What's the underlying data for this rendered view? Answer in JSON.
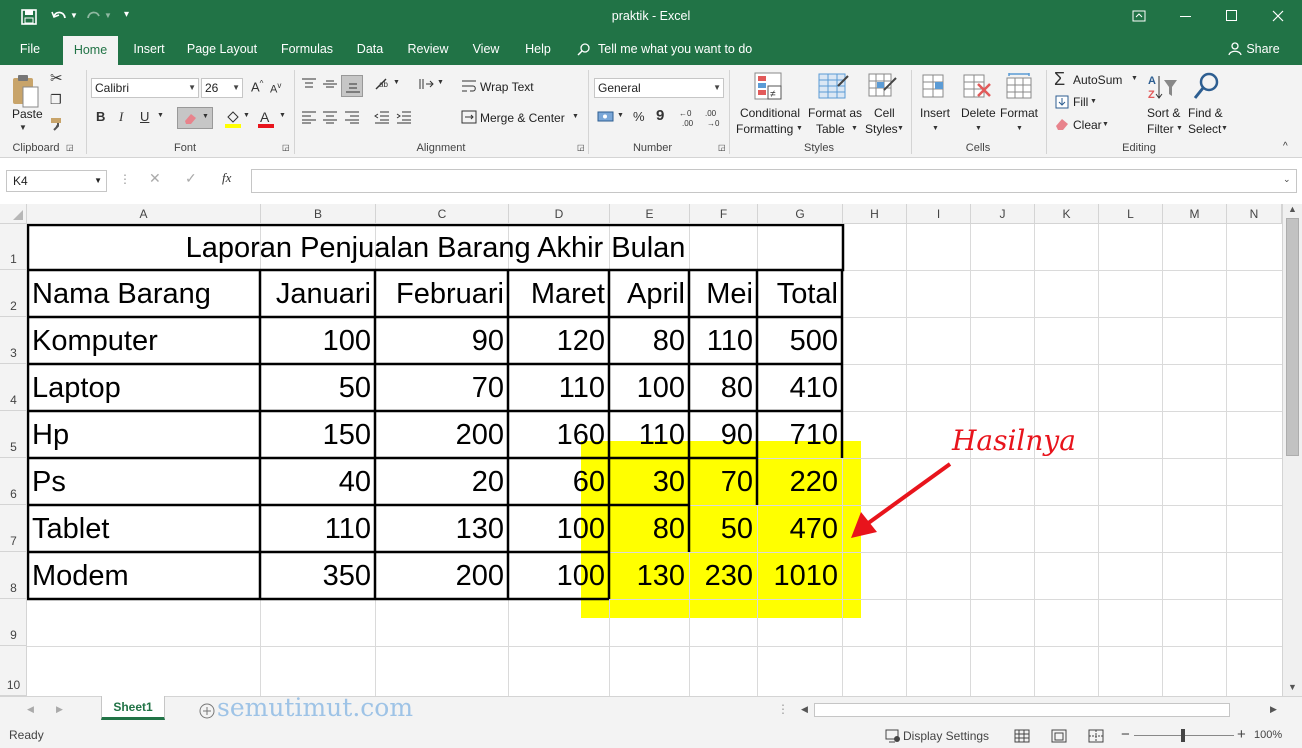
{
  "titlebar": {
    "title": "praktik  -  Excel",
    "restore_icon": "ribbon-display-icon",
    "colors": {
      "green": "#217346"
    }
  },
  "tabs": [
    {
      "label": "File"
    },
    {
      "label": "Home"
    },
    {
      "label": "Insert"
    },
    {
      "label": "Page Layout"
    },
    {
      "label": "Formulas"
    },
    {
      "label": "Data"
    },
    {
      "label": "Review"
    },
    {
      "label": "View"
    },
    {
      "label": "Help"
    }
  ],
  "tell_me": "Tell me what you want to do",
  "share": "Share",
  "ribbon": {
    "clipboard": {
      "paste": "Paste",
      "label": "Clipboard"
    },
    "font": {
      "name": "Calibri",
      "size": "26",
      "label": "Font",
      "bold": "B",
      "italic": "I",
      "underline": "U"
    },
    "alignment": {
      "wrap": "Wrap Text",
      "merge": "Merge & Center",
      "label": "Alignment"
    },
    "number": {
      "format": "General",
      "percent": "%",
      "comma": "9",
      "label": "Number"
    },
    "styles": {
      "conditional": [
        "Conditional",
        "Formatting"
      ],
      "format_table": [
        "Format as",
        "Table"
      ],
      "cell_styles": [
        "Cell",
        "Styles"
      ],
      "label": "Styles"
    },
    "cells": {
      "insert": "Insert",
      "delete": "Delete",
      "format": "Format",
      "label": "Cells"
    },
    "editing": {
      "autosum": "AutoSum",
      "fill": "Fill",
      "clear": "Clear",
      "sort": [
        "Sort &",
        "Filter"
      ],
      "find": [
        "Find &",
        "Select"
      ],
      "label": "Editing"
    }
  },
  "formula_bar": {
    "name_box": "K4",
    "fx": "fx",
    "formula": ""
  },
  "columns": [
    "A",
    "B",
    "C",
    "D",
    "E",
    "F",
    "G",
    "H",
    "I",
    "J",
    "K",
    "L",
    "M",
    "N"
  ],
  "rows": [
    "1",
    "2",
    "3",
    "4",
    "5",
    "6",
    "7",
    "8",
    "9",
    "10"
  ],
  "sheet": {
    "title": "Laporan Penjualan Barang Akhir Bulan",
    "headers": [
      "Nama Barang",
      "Januari",
      "Februari",
      "Maret",
      "April",
      "Mei",
      "Total"
    ],
    "data": [
      [
        "Komputer",
        "100",
        "90",
        "120",
        "80",
        "110",
        "500"
      ],
      [
        "Laptop",
        "50",
        "70",
        "110",
        "100",
        "80",
        "410"
      ],
      [
        "Hp",
        "150",
        "200",
        "160",
        "110",
        "90",
        "710"
      ],
      [
        "Ps",
        "40",
        "20",
        "60",
        "30",
        "70",
        "220"
      ],
      [
        "Tablet",
        "110",
        "130",
        "100",
        "80",
        "50",
        "470"
      ],
      [
        "Modem",
        "350",
        "200",
        "100",
        "130",
        "230",
        "1010"
      ]
    ],
    "highlight_color": "#ffff00"
  },
  "annotation": {
    "text": "Hasilnya",
    "color": "#e8141c"
  },
  "watermark": "semutimut.com",
  "sheet_tab": "Sheet1",
  "status": {
    "ready": "Ready",
    "display_settings": "Display Settings",
    "zoom": "100%"
  }
}
